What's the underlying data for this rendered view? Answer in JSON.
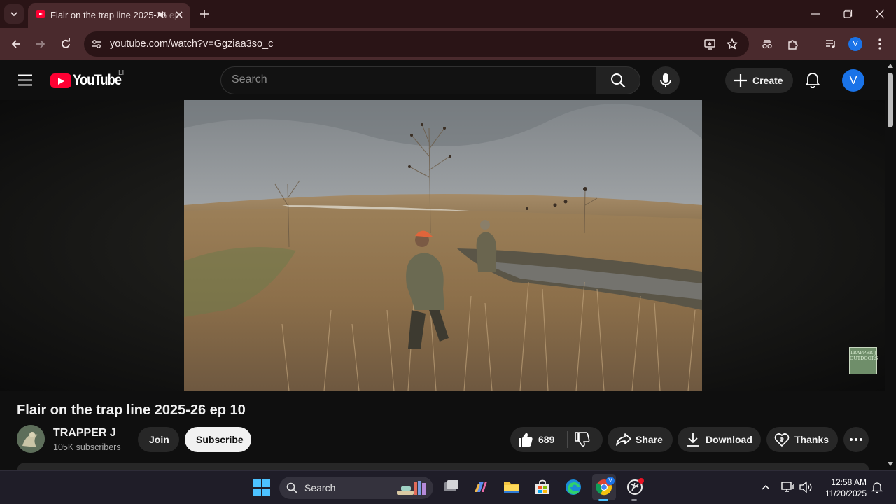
{
  "browser": {
    "tab_title": "Flair on the trap line 2025-26 ep 10",
    "url": "youtube.com/watch?v=Ggziaa3so_c",
    "profile_initial": "V"
  },
  "youtube": {
    "logo_text": "YouTube",
    "country_code": "LI",
    "search_placeholder": "Search",
    "create_label": "Create",
    "avatar_initial": "V"
  },
  "video": {
    "title": "Flair on the trap line 2025-26 ep 10",
    "watermark_text": "TRAPPER J OUTDOORS"
  },
  "channel": {
    "name": "TRAPPER J",
    "subscribers": "105K subscribers",
    "join_label": "Join",
    "subscribe_label": "Subscribe"
  },
  "actions": {
    "like_count": "689",
    "share_label": "Share",
    "download_label": "Download",
    "thanks_label": "Thanks"
  },
  "taskbar": {
    "search_label": "Search",
    "time": "12:58 AM",
    "date": "11/20/2025"
  },
  "colors": {
    "brand_red": "#ff0033",
    "chrome_frame": "#4a2a2d",
    "accent_blue": "#1a73e8"
  }
}
